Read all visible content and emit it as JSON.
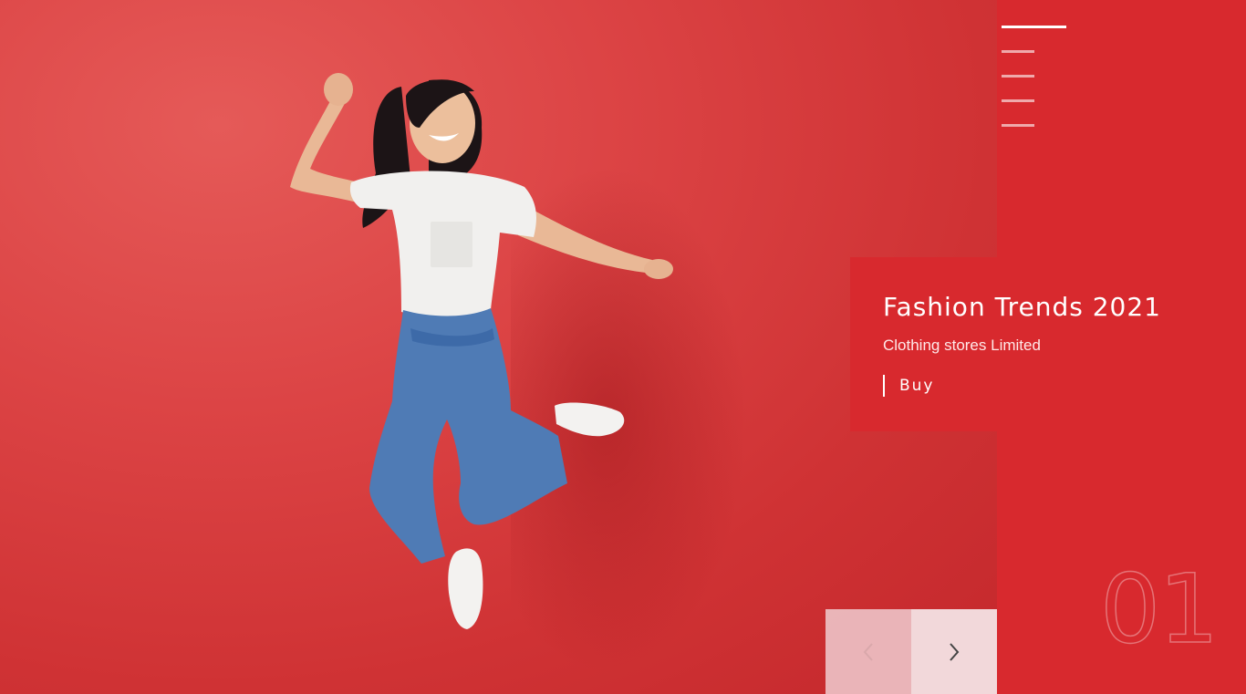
{
  "hero": {
    "image_alt": "Woman in white t-shirt and jeans jumping against red wall"
  },
  "slider": {
    "slides_count": 5,
    "active_index": 0,
    "current_number": "01"
  },
  "caption": {
    "title": "Fashion Trends 2021",
    "subtitle": "Clothing stores Limited",
    "cta_label": "Buy"
  },
  "nav": {
    "prev_icon": "chevron-left-icon",
    "next_icon": "chevron-right-icon"
  },
  "colors": {
    "accent_red": "#d8292e",
    "background_red": "#dc4445",
    "arrow_panel": "#f2d8da"
  }
}
